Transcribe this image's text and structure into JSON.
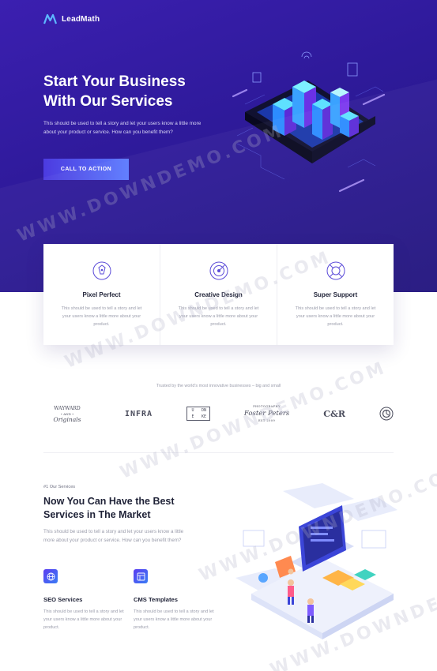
{
  "brand": {
    "name": "LeadMath"
  },
  "hero": {
    "title_line1": "Start Your Business",
    "title_line2": "With Our Services",
    "text": "This should be used to tell a story and let your users know a little more about your product or service. How can you benefit them?",
    "cta_label": "CALL TO ACTION"
  },
  "features": [
    {
      "title": "Pixel Perfect",
      "text": "This should be used to tell a story and let your users know a little more about your product.",
      "icon": "pen-nib-icon"
    },
    {
      "title": "Creative Design",
      "text": "This should be used to tell a story and let your users know a little more about your product.",
      "icon": "target-icon"
    },
    {
      "title": "Super Support",
      "text": "This should be used to tell a story and let your users know a little more about your product.",
      "icon": "lifebuoy-icon"
    }
  ],
  "trusted": {
    "label": "Trusted by the world's most innovative businesses – big and small",
    "brands": {
      "wayward_top": "WAYWARD",
      "wayward_mid": "• AND •",
      "wayward_bottom": "Originals",
      "infra": "INFRA",
      "grid": [
        "U",
        "DN",
        "E",
        "KE"
      ],
      "foster_top": "PHOTOGRAPHY",
      "foster": "Foster Peters",
      "foster_bottom": "EST 2009",
      "cr": "C&R"
    }
  },
  "services": {
    "eyebrow": "#1 Our Services",
    "title_line1": "Now You Can Have the Best",
    "title_line2": "Services in The Market",
    "text": "This should be used to tell a story and let your users know a little more about your product or service. How can you benefit them?",
    "items": [
      {
        "title": "SEO Services",
        "text": "This should be used to tell a story and let your users know a little more about your product.",
        "icon": "globe-icon"
      },
      {
        "title": "CMS Templates",
        "text": "This should be used to tell a story and let your users know a little more about your product.",
        "icon": "layout-icon"
      }
    ]
  },
  "watermark": "WWW.DOWNDEMO.COM",
  "colors": {
    "hero_bg": "#2e1a9a",
    "accent": "#4c3be0",
    "cta_end": "#5c7bff"
  }
}
